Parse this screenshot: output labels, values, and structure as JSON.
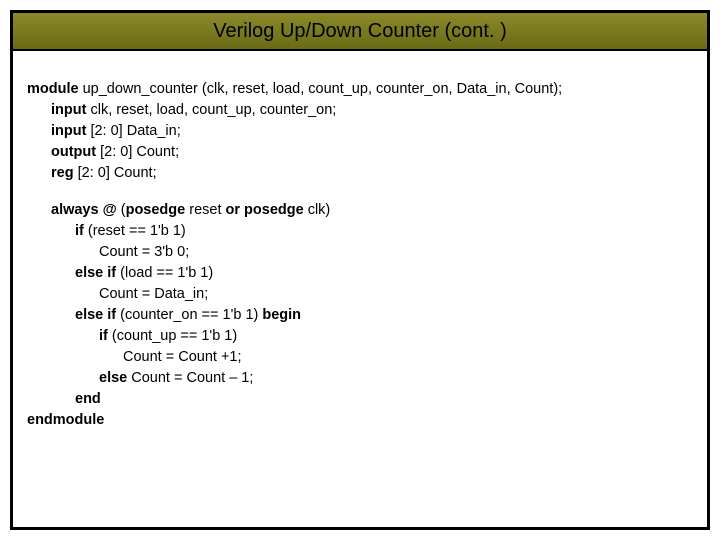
{
  "title": "Verilog Up/Down Counter (cont. )",
  "code": {
    "l1a": "module",
    "l1b": " up_down_counter (clk, reset, load, count_up, counter_on, Data_in, Count);",
    "l2a": "input",
    "l2b": " clk, reset, load, count_up, counter_on;",
    "l3a": "input",
    "l3b": " [2: 0] Data_in;",
    "l4a": "output",
    "l4b": " [2: 0] Count;",
    "l5a": "reg",
    "l5b": " [2: 0] Count;",
    "l6a": "always @",
    "l6b": " (",
    "l6c": "posedge",
    "l6d": " reset ",
    "l6e": "or",
    "l6f": " ",
    "l6g": "posedge",
    "l6h": " clk)",
    "l7a": "if",
    "l7b": " (reset == 1'b 1)",
    "l8": "Count = 3'b 0;",
    "l9a": "else if",
    "l9b": " (load == 1'b 1)",
    "l10": "Count = Data_in;",
    "l11a": "else if",
    "l11b": " (counter_on == 1'b 1) ",
    "l11c": "begin",
    "l12a": "if",
    "l12b": " (count_up == 1'b 1)",
    "l13": "Count = Count +1;",
    "l14a": "else",
    "l14b": " Count = Count – 1;",
    "l15": "end",
    "l16": "endmodule"
  }
}
